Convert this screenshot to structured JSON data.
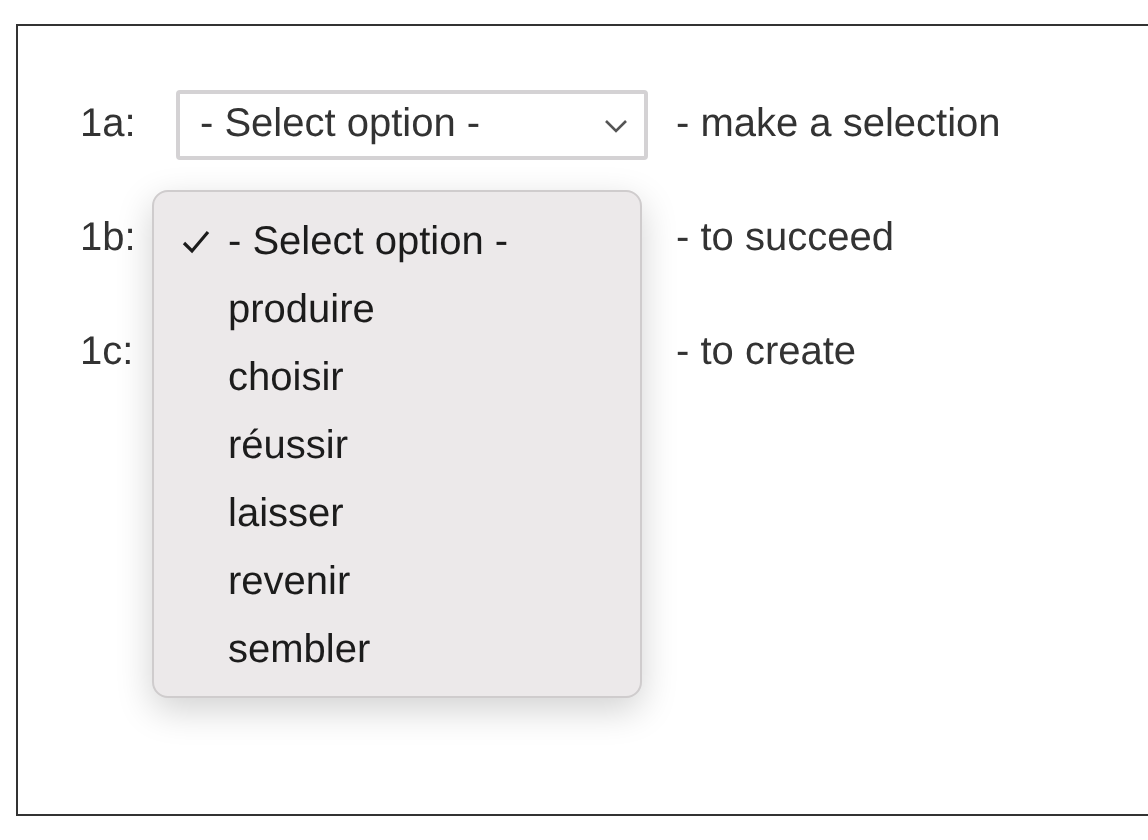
{
  "rows": [
    {
      "label": "1a:",
      "select_value": "- Select option -",
      "description": "- make a selection"
    },
    {
      "label": "1b:",
      "description": "- to succeed"
    },
    {
      "label": "1c:",
      "description": "- to create"
    }
  ],
  "dropdown_menu": {
    "options": [
      {
        "text": "- Select option -",
        "selected": true
      },
      {
        "text": "produire",
        "selected": false
      },
      {
        "text": "choisir",
        "selected": false
      },
      {
        "text": "réussir",
        "selected": false
      },
      {
        "text": "laisser",
        "selected": false
      },
      {
        "text": "revenir",
        "selected": false
      },
      {
        "text": "sembler",
        "selected": false
      }
    ]
  }
}
